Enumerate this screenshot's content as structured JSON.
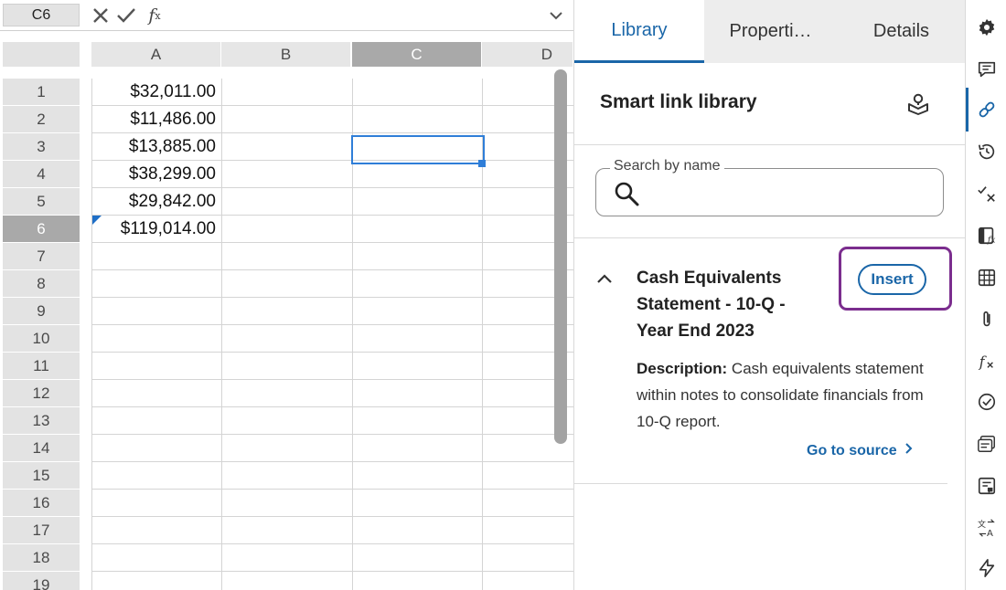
{
  "formula_bar": {
    "name_box": "C6",
    "fx_label": "f",
    "fx_sub": "x"
  },
  "columns": [
    "A",
    "B",
    "C",
    "D"
  ],
  "active_column": "C",
  "rows": [
    "1",
    "2",
    "3",
    "4",
    "5",
    "6",
    "7",
    "8",
    "9",
    "10",
    "11",
    "12",
    "13",
    "14",
    "15",
    "16",
    "17",
    "18",
    "19"
  ],
  "active_row": "6",
  "column_a_values": [
    "$32,011.00",
    "$11,486.00",
    "$13,885.00",
    "$38,299.00",
    "$29,842.00",
    "$119,014.00"
  ],
  "panel": {
    "tabs": [
      {
        "label": "Library",
        "active": true
      },
      {
        "label": "Properti…",
        "active": false
      },
      {
        "label": "Details",
        "active": false
      }
    ],
    "title": "Smart link library",
    "search": {
      "label": "Search by name",
      "value": ""
    },
    "item": {
      "title_lines": [
        "Cash Equivalents",
        "Statement - 10-Q -",
        "Year End 2023"
      ],
      "insert_label": "Insert",
      "description_label": "Description:",
      "description_text": " Cash equivalents statement within notes to consolidate financials from 10-Q report.",
      "go_to_source": "Go to source"
    }
  },
  "rail": {
    "icons": [
      "gear-icon",
      "comment-icon",
      "link-icon",
      "history-icon",
      "check-x-icon",
      "sheet-formula-icon",
      "table-icon",
      "attachment-icon",
      "function-icon",
      "check-circle-icon",
      "list-detail-icon",
      "comment-box-icon",
      "translate-icon",
      "lightning-icon"
    ],
    "active": "link-icon"
  },
  "colors": {
    "accent": "#1a66a8",
    "highlight": "#7b2d8e",
    "active_cell": "#2f7ed8"
  }
}
